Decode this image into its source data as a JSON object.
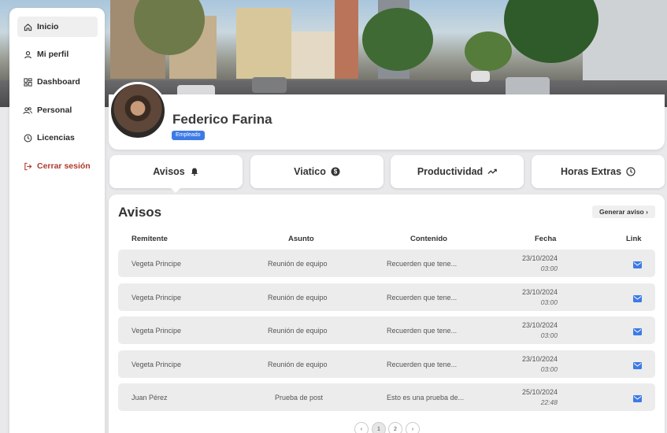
{
  "sidebar": {
    "items": [
      {
        "label": "Inicio",
        "icon": "home-icon",
        "active": true
      },
      {
        "label": "Mi perfil",
        "icon": "user-icon"
      },
      {
        "label": "Dashboard",
        "icon": "dashboard-icon"
      },
      {
        "label": "Personal",
        "icon": "users-icon"
      },
      {
        "label": "Licencias",
        "icon": "clock-icon"
      },
      {
        "label": "Cerrar sesión",
        "icon": "logout-icon"
      }
    ]
  },
  "profile": {
    "name": "Federico Farina",
    "role": "Empleado"
  },
  "tabs": [
    {
      "label": "Avisos",
      "icon": "bell-icon"
    },
    {
      "label": "Viatico",
      "icon": "dollar-icon"
    },
    {
      "label": "Productividad",
      "icon": "trend-icon"
    },
    {
      "label": "Horas Extras",
      "icon": "clock-icon"
    }
  ],
  "avisos": {
    "title": "Avisos",
    "generate_label": "Generar aviso ›",
    "headers": [
      "Remitente",
      "Asunto",
      "Contenido",
      "Fecha",
      "Link"
    ],
    "rows": [
      {
        "remitente": "Vegeta Principe",
        "asunto": "Reunión de equipo",
        "contenido": "Recuerden que tene...",
        "fecha": "23/10/2024",
        "hora": "03:00"
      },
      {
        "remitente": "Vegeta Principe",
        "asunto": "Reunión de equipo",
        "contenido": "Recuerden que tene...",
        "fecha": "23/10/2024",
        "hora": "03:00"
      },
      {
        "remitente": "Vegeta Principe",
        "asunto": "Reunión de equipo",
        "contenido": "Recuerden que tene...",
        "fecha": "23/10/2024",
        "hora": "03:00"
      },
      {
        "remitente": "Vegeta Principe",
        "asunto": "Reunión de equipo",
        "contenido": "Recuerden que tene...",
        "fecha": "23/10/2024",
        "hora": "03:00"
      },
      {
        "remitente": "Juan Pérez",
        "asunto": "Prueba de post",
        "contenido": "Esto es una prueba de...",
        "fecha": "25/10/2024",
        "hora": "22:48"
      }
    ]
  },
  "pagination": {
    "prev": "‹",
    "pages": [
      "1",
      "2"
    ],
    "next": "›"
  },
  "colors": {
    "accent": "#3d7ae6",
    "logout": "#b0392b"
  }
}
